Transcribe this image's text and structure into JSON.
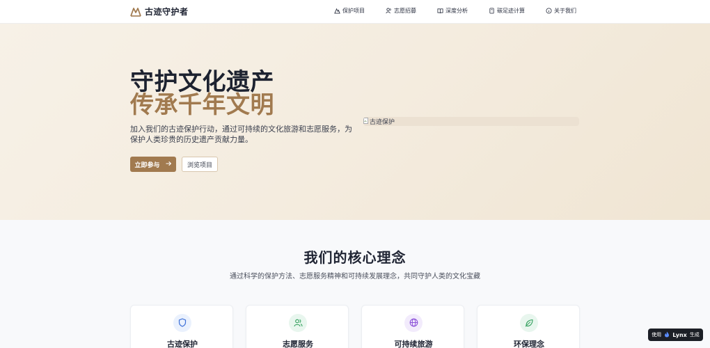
{
  "header": {
    "brand_name": "古迹守护者",
    "nav": [
      {
        "label": "保护项目",
        "icon": "landmark-icon"
      },
      {
        "label": "志愿招募",
        "icon": "users-icon"
      },
      {
        "label": "深度分析",
        "icon": "book-open-icon"
      },
      {
        "label": "碳足迹计算",
        "icon": "calculator-icon"
      },
      {
        "label": "关于我们",
        "icon": "info-icon"
      }
    ]
  },
  "hero": {
    "title_line1": "守护文化遗产",
    "title_line2": "传承千年文明",
    "description": "加入我们的古迹保护行动，通过可持续的文化旅游和志愿服务，为保护人类珍贵的历史遗产贡献力量。",
    "primary_button": "立即参与",
    "secondary_button": "浏览项目",
    "image_alt": "古迹保护"
  },
  "core": {
    "title": "我们的核心理念",
    "subtitle": "通过科学的保护方法、志愿服务精神和可持续发展理念，共同守护人类的文化宝藏",
    "cards": [
      {
        "title": "古迹保护",
        "icon": "shield-icon",
        "color": "#3b6fd8",
        "bg": "#eaf1fd"
      },
      {
        "title": "志愿服务",
        "icon": "users-icon",
        "color": "#2f9e5a",
        "bg": "#e8f6ee"
      },
      {
        "title": "可持续旅游",
        "icon": "globe-icon",
        "color": "#8a4fd8",
        "bg": "#f2ebfc"
      },
      {
        "title": "环保理念",
        "icon": "leaf-icon",
        "color": "#2f9e5a",
        "bg": "#e8f6ee"
      }
    ]
  },
  "badge": {
    "prefix": "使用",
    "brand": "Lynx",
    "suffix": "生成"
  },
  "colors": {
    "accent": "#a17a4f",
    "dark": "#1d2230"
  }
}
